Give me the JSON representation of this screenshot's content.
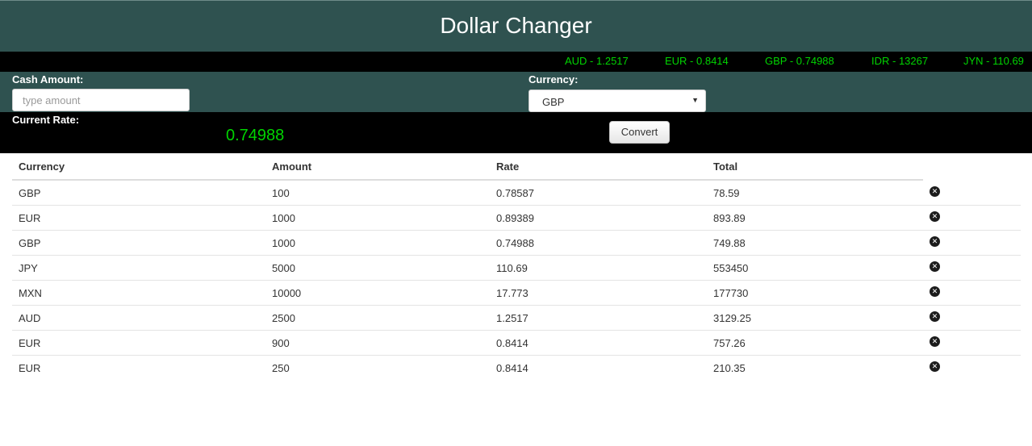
{
  "header": {
    "title": "Dollar Changer"
  },
  "ticker": [
    {
      "text": "AUD - 1.2517"
    },
    {
      "text": "EUR - 0.8414"
    },
    {
      "text": "GBP - 0.74988"
    },
    {
      "text": "IDR - 13267"
    },
    {
      "text": "JYN - 110.69"
    }
  ],
  "form": {
    "cash_label": "Cash Amount:",
    "cash_placeholder": "type amount",
    "cash_value": "",
    "currency_label": "Currency:",
    "currency_selected": "GBP",
    "rate_label": "Current Rate:",
    "rate_value": "0.74988",
    "convert_label": "Convert"
  },
  "table": {
    "headers": [
      "Currency",
      "Amount",
      "Rate",
      "Total"
    ],
    "rows": [
      [
        "GBP",
        "100",
        "0.78587",
        "78.59"
      ],
      [
        "EUR",
        "1000",
        "0.89389",
        "893.89"
      ],
      [
        "GBP",
        "1000",
        "0.74988",
        "749.88"
      ],
      [
        "JPY",
        "5000",
        "110.69",
        "553450"
      ],
      [
        "MXN",
        "10000",
        "17.773",
        "177730"
      ],
      [
        "AUD",
        "2500",
        "1.2517",
        "3129.25"
      ],
      [
        "EUR",
        "900",
        "0.8414",
        "757.26"
      ],
      [
        "EUR",
        "250",
        "0.8414",
        "210.35"
      ]
    ]
  },
  "icons": {
    "delete": "remove-circle-icon"
  },
  "colors": {
    "header_bg": "#2f5250",
    "ticker_text": "#00d400",
    "dark_band": "#000000"
  }
}
